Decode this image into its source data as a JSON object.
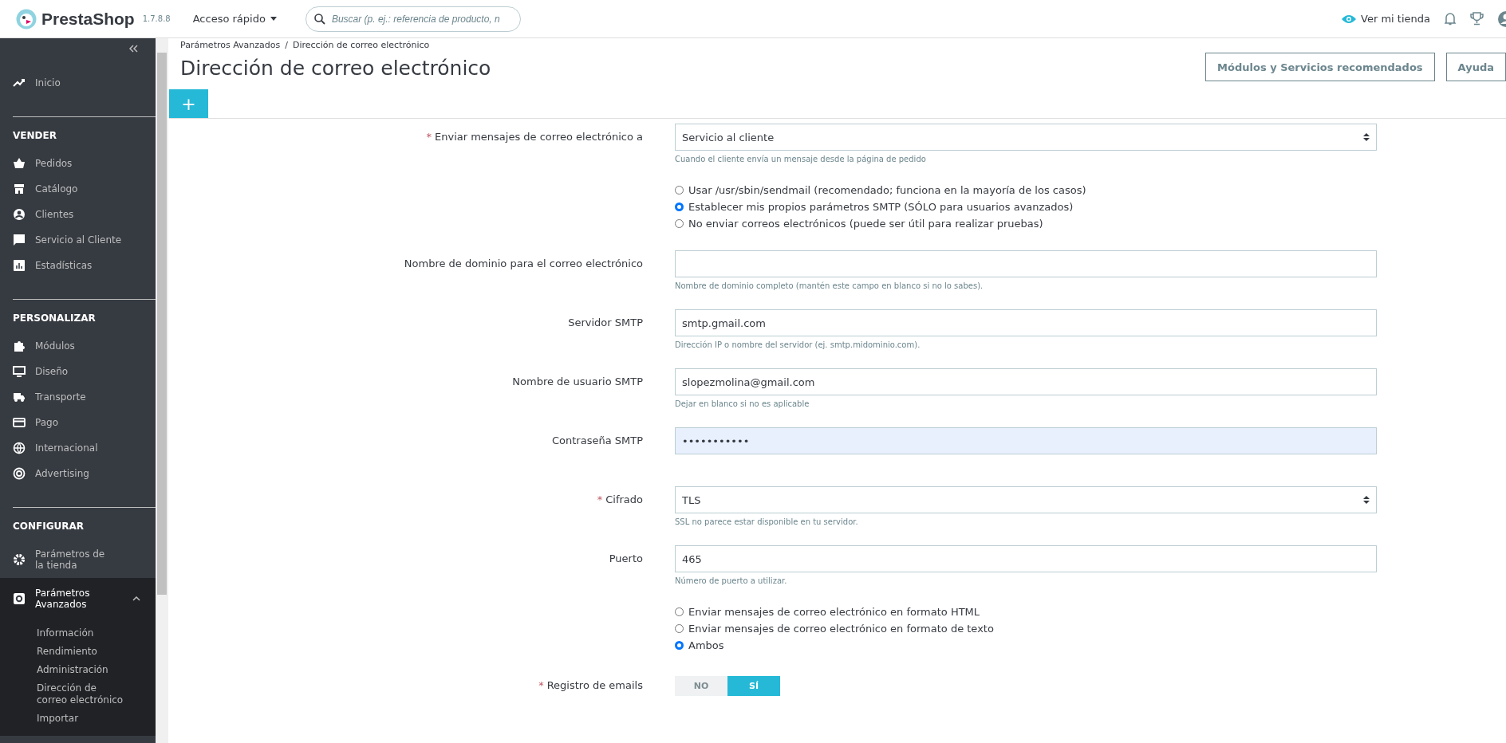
{
  "topbar": {
    "logo": "PrestaShop",
    "version": "1.7.8.8",
    "quick_access": "Acceso rápido",
    "search": {
      "placeholder": "Buscar (p. ej.: referencia de producto, n"
    },
    "view_store": "Ver mi tienda"
  },
  "sidebar": {
    "top_items": [
      {
        "label": "Inicio",
        "selected": false
      }
    ],
    "sections": [
      {
        "title": "VENDER",
        "items": [
          {
            "label": "Pedidos",
            "selected": false
          },
          {
            "label": "Catálogo",
            "selected": false
          },
          {
            "label": "Clientes",
            "selected": false
          },
          {
            "label": "Servicio al Cliente",
            "selected": false
          },
          {
            "label": "Estadísticas",
            "selected": false
          }
        ]
      },
      {
        "title": "PERSONALIZAR",
        "items": [
          {
            "label": "Módulos",
            "selected": false
          },
          {
            "label": "Diseño",
            "selected": false
          },
          {
            "label": "Transporte",
            "selected": false
          },
          {
            "label": "Pago",
            "selected": false
          },
          {
            "label": "Internacional",
            "selected": false
          },
          {
            "label": "Advertising",
            "selected": false
          }
        ]
      },
      {
        "title": "CONFIGURAR",
        "items": [
          {
            "label": "Parámetros de la tienda",
            "selected": false
          },
          {
            "label": "Parámetros Avanzados",
            "selected": true,
            "expanded": true,
            "children": [
              {
                "label": "Información",
                "selected": false
              },
              {
                "label": "Rendimiento",
                "selected": false
              },
              {
                "label": "Administración",
                "selected": false
              },
              {
                "label": "Dirección de correo electrónico",
                "selected": false
              },
              {
                "label": "Importar",
                "selected": false
              }
            ]
          }
        ]
      }
    ]
  },
  "header": {
    "breadcrumb": [
      "Parámetros Avanzados",
      "Dirección de correo electrónico"
    ],
    "breadcrumb_separator": "/",
    "title": "Dirección de correo electrónico",
    "buttons": [
      "Módulos y Servicios recomendados",
      "Ayuda"
    ],
    "add_tab": "+"
  },
  "form": [
    {
      "kind": "select",
      "mark": "*",
      "label": "Enviar mensajes de correo electrónico a",
      "value": "Servicio al cliente",
      "help": "Cuando el cliente envía un mensaje desde la página de pedido"
    },
    {
      "kind": "radio",
      "options": [
        {
          "label": "Usar /usr/sbin/sendmail (recomendado; funciona en la mayoría de los casos)",
          "selected": false
        },
        {
          "label": "Establecer mis propios parámetros SMTP (SÓLO para usuarios avanzados)",
          "selected": true
        },
        {
          "label": "No enviar correos electrónicos (puede ser útil para realizar pruebas)",
          "selected": false
        }
      ]
    },
    {
      "kind": "text",
      "label": "Nombre de dominio para el correo electrónico",
      "help": "Nombre de dominio completo (mantén este campo en blanco si no lo sabes)."
    },
    {
      "kind": "text",
      "label": "Servidor SMTP",
      "value": "smtp.gmail.com",
      "help": "Dirección IP o nombre del servidor (ej. smtp.midominio.com)."
    },
    {
      "kind": "text",
      "label": "Nombre de usuario SMTP",
      "value": "slopezmolina@gmail.com",
      "help": "Dejar en blanco si no es aplicable"
    },
    {
      "kind": "password",
      "label": "Contraseña SMTP",
      "value": "•••••••••••"
    },
    {
      "kind": "select",
      "mark": "*",
      "label": "Cifrado",
      "value": "TLS",
      "help": "SSL no parece estar disponible en tu servidor."
    },
    {
      "kind": "text",
      "label": "Puerto",
      "value": "465",
      "help": "Número de puerto a utilizar."
    },
    {
      "kind": "radio",
      "options": [
        {
          "label": "Enviar mensajes de correo electrónico en formato HTML",
          "selected": false
        },
        {
          "label": "Enviar mensajes de correo electrónico en formato de texto",
          "selected": false
        },
        {
          "label": "Ambos",
          "selected": true
        }
      ]
    },
    {
      "kind": "switch",
      "mark": "*",
      "label": "Registro de emails",
      "options": [
        {
          "label": "NO",
          "selected": false
        },
        {
          "label": "SÍ",
          "selected": true
        }
      ]
    }
  ]
}
